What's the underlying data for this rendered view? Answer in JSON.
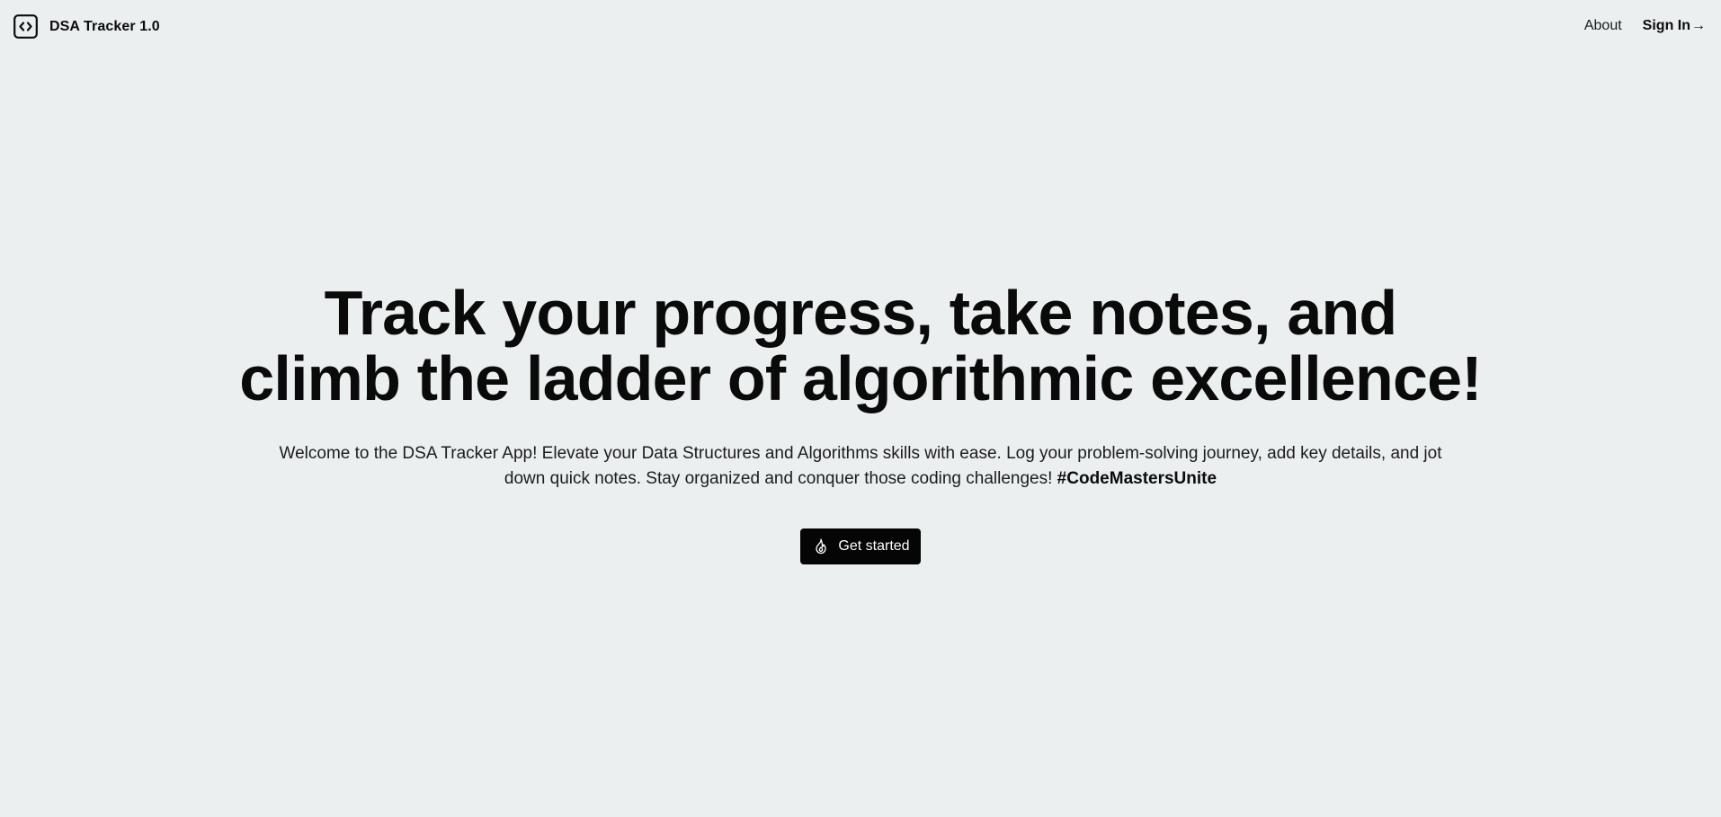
{
  "brand": {
    "name": "DSA Tracker 1.0",
    "icon": "code-brackets-icon"
  },
  "nav": {
    "about": "About",
    "sign_in": "Sign In",
    "sign_in_arrow": "→"
  },
  "hero": {
    "headline_line1": "Track your progress, take notes, and",
    "headline_line2": "climb the ladder of algorithmic excellence!",
    "description": "Welcome to the DSA Tracker App! Elevate your Data Structures and Algorithms skills with ease. Log your problem-solving journey, add key details, and jot down quick notes. Stay organized and conquer those coding challenges!",
    "hashtag": "#CodeMastersUnite",
    "cta_label": "Get started",
    "cta_icon": "flame-icon"
  },
  "colors": {
    "background": "#ebeff0",
    "text": "#0c0c0c",
    "button_bg": "#050505",
    "button_text": "#ffffff"
  }
}
